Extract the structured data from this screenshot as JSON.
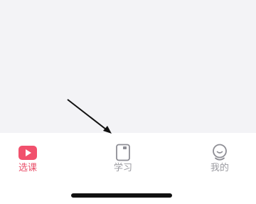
{
  "tabbar": {
    "tabs": [
      {
        "label": "选课",
        "icon": "video-play-icon",
        "active": true
      },
      {
        "label": "学习",
        "icon": "notebook-icon",
        "active": false
      },
      {
        "label": "我的",
        "icon": "profile-face-icon",
        "active": false
      }
    ]
  },
  "colors": {
    "active": "#e9506a",
    "inactive": "#9a9aa0",
    "content_bg": "#f3f3f6"
  }
}
